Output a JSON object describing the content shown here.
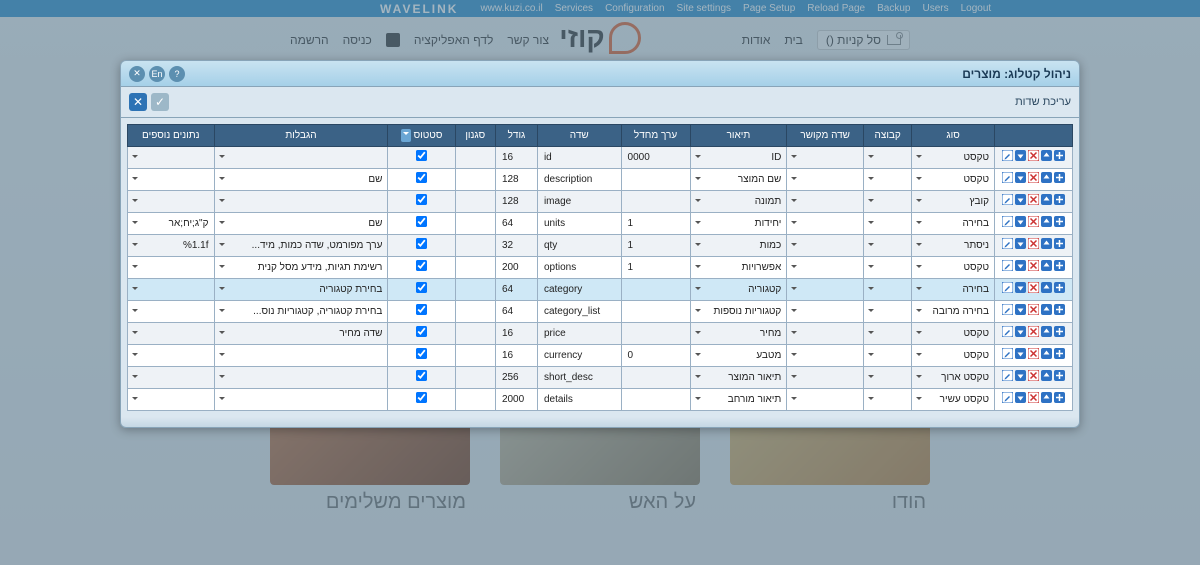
{
  "topbar": {
    "brand": "WAVELINK",
    "links": [
      "www.kuzi.co.il",
      "Services",
      "Configuration",
      "Site settings",
      "Page Setup",
      "Reload Page",
      "Backup",
      "Users",
      "Logout"
    ]
  },
  "site": {
    "cart": "סל קניות ()",
    "nav_right": [
      "בית",
      "אודות"
    ],
    "nav_left": [
      "צור קשר",
      "לדף האפליקציה",
      "כניסה",
      "הרשמה"
    ],
    "logo_text": "קוזי"
  },
  "tiles": [
    {
      "caption": "הודו"
    },
    {
      "caption": "על האש"
    },
    {
      "caption": "מוצרים משלימים"
    }
  ],
  "panel": {
    "title": "ניהול קטלוג: מוצרים",
    "subtitle": "עריכת שדות"
  },
  "columns": {
    "actions": "",
    "type": "סוג",
    "group": "קבוצה",
    "linked": "שדה מקושר",
    "desc": "תיאור",
    "default": "ערך מחדל",
    "field": "שדה",
    "size": "גודל",
    "style": "סגנון",
    "status": "סטטוס",
    "limits": "הגבלות",
    "extra": "נתונים נוספים"
  },
  "rows": [
    {
      "type": "טקסט",
      "desc": "ID",
      "default": "0000",
      "field": "id",
      "size": "16",
      "status": true,
      "limits": "",
      "extra": "",
      "hl": false
    },
    {
      "type": "טקסט",
      "desc": "שם המוצר",
      "default": "",
      "field": "description",
      "size": "128",
      "status": true,
      "limits": "שם",
      "extra": "",
      "hl": false
    },
    {
      "type": "קובץ",
      "desc": "תמונה",
      "default": "",
      "field": "image",
      "size": "128",
      "status": true,
      "limits": "",
      "extra": "",
      "hl": false
    },
    {
      "type": "בחירה",
      "desc": "יחידות",
      "default": "1",
      "field": "units",
      "size": "64",
      "status": true,
      "limits": "שם",
      "extra": "ק\"ג;יח;אר",
      "hl": false
    },
    {
      "type": "ניסתר",
      "desc": "כמות",
      "default": "1",
      "field": "qty",
      "size": "32",
      "status": true,
      "limits": "ערך מפורמט, שדה כמות, מיד...",
      "extra": "%1.1f",
      "hl": false
    },
    {
      "type": "טקסט",
      "desc": "אפשרויות",
      "default": "1",
      "field": "options",
      "size": "200",
      "status": true,
      "limits": "רשימת תגיות, מידע מסל קנית",
      "extra": "",
      "hl": false
    },
    {
      "type": "בחירה",
      "desc": "קטגוריה",
      "default": "",
      "field": "category",
      "size": "64",
      "status": true,
      "limits": "בחירת קטגוריה",
      "extra": "",
      "hl": true
    },
    {
      "type": "בחירה מרובה",
      "desc": "קטגוריות נוספות",
      "default": "",
      "field": "category_list",
      "size": "64",
      "status": true,
      "limits": "בחירת קטגוריה, קטגוריות נוס...",
      "extra": "",
      "hl": false
    },
    {
      "type": "טקסט",
      "desc": "מחיר",
      "default": "",
      "field": "price",
      "size": "16",
      "status": true,
      "limits": "שדה מחיר",
      "extra": "",
      "hl": false
    },
    {
      "type": "טקסט",
      "desc": "מטבע",
      "default": "0",
      "field": "currency",
      "size": "16",
      "status": true,
      "limits": "",
      "extra": "",
      "hl": false
    },
    {
      "type": "טקסט ארוך",
      "desc": "תיאור המוצר",
      "default": "",
      "field": "short_desc",
      "size": "256",
      "status": true,
      "limits": "",
      "extra": "",
      "hl": false
    },
    {
      "type": "טקסט עשיר",
      "desc": "תיאור מורחב",
      "default": "",
      "field": "details",
      "size": "2000",
      "status": true,
      "limits": "",
      "extra": "",
      "hl": false
    }
  ]
}
